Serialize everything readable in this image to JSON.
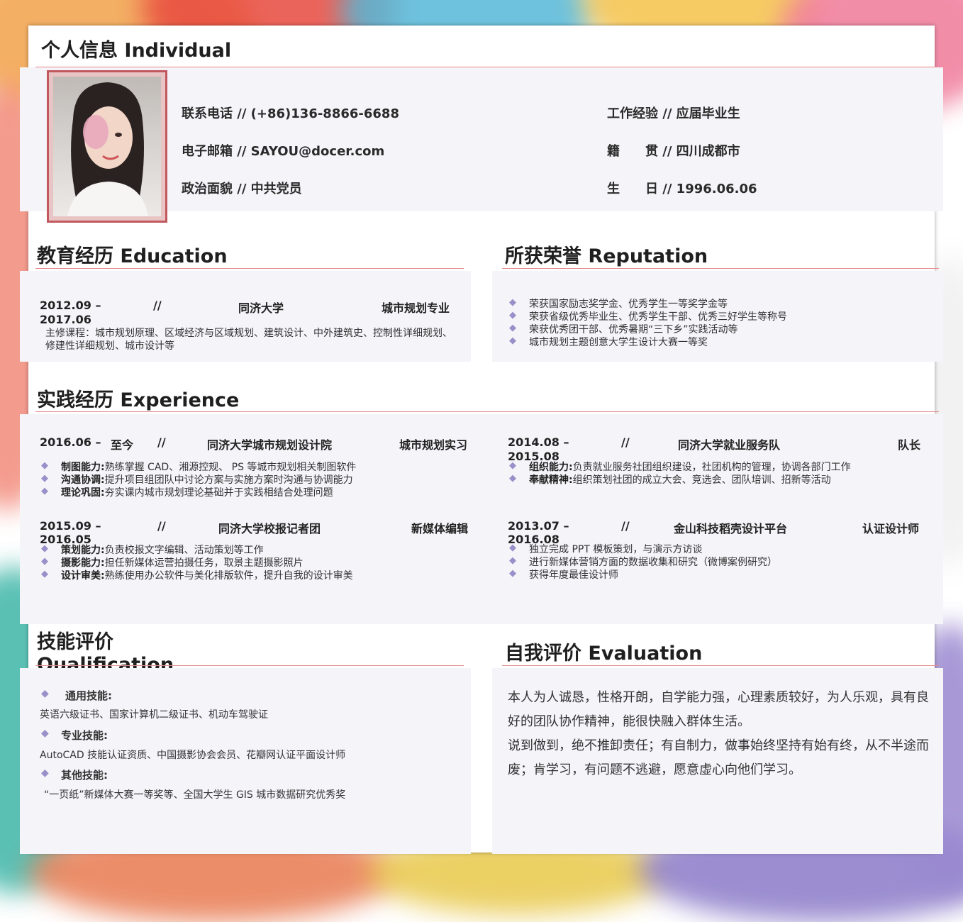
{
  "personal": {
    "title": "个人信息 Individual",
    "phone": "联系电话 // (+86)136-8866-6688",
    "email": "电子邮箱 // SAYOU@docer.com",
    "politics": "政治面貌 // 中共党员",
    "experience": "工作经验 // 应届毕业生",
    "hometown": "籍　　贯 // 四川成都市",
    "birthday": "生　　日 // 1996.06.06"
  },
  "education": {
    "title": "教育经历 Education",
    "date_start": "2012.09 –",
    "date_end": "2017.06",
    "sep": "//",
    "school": "同济大学",
    "major": "城市规划专业",
    "courses": "主修课程：城市规划原理、区域经济与区域规划、建筑设计、中外建筑史、控制性详细规划、修建性详细规划、城市设计等"
  },
  "reputation": {
    "title": "所获荣誉 Reputation",
    "items": [
      "荣获国家励志奖学金、优秀学生一等奖学金等",
      "荣获省级优秀毕业生、优秀学生干部、优秀三好学生等称号",
      "荣获优秀团干部、优秀暑期“三下乡”实践活动等",
      "城市规划主题创意大学生设计大赛一等奖"
    ]
  },
  "experience": {
    "title": "实践经历 Experience",
    "entries": [
      {
        "date_start": "2016.06 –",
        "date_end": "至今",
        "sep": "//",
        "org": "同济大学城市规划设计院",
        "role": "城市规划实习",
        "points": [
          {
            "label": "制图能力:",
            "text": "熟练掌握 CAD、湘源控规、 PS 等城市规划相关制图软件"
          },
          {
            "label": "沟通协调:",
            "text": "提升项目组团队中讨论方案与实施方案时沟通与协调能力"
          },
          {
            "label": "理论巩固:",
            "text": "夯实课内城市规划理论基础并于实践相结合处理问题"
          }
        ]
      },
      {
        "date_start": "2015.09 –",
        "date_end": "2016.05",
        "sep": "//",
        "org": "同济大学校报记者团",
        "role": "新媒体编辑",
        "points": [
          {
            "label": "策划能力:",
            "text": "负责校报文字编辑、活动策划等工作"
          },
          {
            "label": "摄影能力:",
            "text": "担任新媒体运营拍摄任务，取景主题摄影照片"
          },
          {
            "label": "设计审美:",
            "text": "熟练使用办公软件与美化排版软件，提升自我的设计审美"
          }
        ]
      },
      {
        "date_start": "2014.08 –",
        "date_end": "2015.08",
        "sep": "//",
        "org": "同济大学就业服务队",
        "role": "队长",
        "points": [
          {
            "label": "组织能力:",
            "text": "负责就业服务社团组织建设，社团机构的管理，协调各部门工作"
          },
          {
            "label": "奉献精神:",
            "text": "组织策划社团的成立大会、竞选会、团队培训、招新等活动"
          }
        ]
      },
      {
        "date_start": "2013.07 –",
        "date_end": "2016.08",
        "sep": "//",
        "org": "金山科技稻壳设计平台",
        "role": "认证设计师",
        "points": [
          {
            "label": "",
            "text": "独立完成 PPT 模板策划，与演示方访谈"
          },
          {
            "label": "",
            "text": "进行新媒体营销方面的数据收集和研究（微博案例研究）"
          },
          {
            "label": "",
            "text": "获得年度最佳设计师"
          }
        ]
      }
    ]
  },
  "qualification": {
    "title_cn": "技能评价",
    "title_en": "Qualification",
    "groups": [
      {
        "label": "通用技能:",
        "text": "英语六级证书、国家计算机二级证书、机动车驾驶证"
      },
      {
        "label": "专业技能:",
        "text": "AutoCAD 技能认证资质、中国摄影协会会员、花瓣网认证平面设计师"
      },
      {
        "label": "其他技能:",
        "text": "“一页纸”新媒体大赛一等奖等、全国大学生 GIS 城市数据研究优秀奖"
      }
    ]
  },
  "evaluation": {
    "title": "自我评价 Evaluation",
    "para1": "本人为人诚恳，性格开朗，自学能力强，心理素质较好，为人乐观，具有良好的团队协作精神，能很快融入群体生活。",
    "para2": "说到做到，绝不推卸责任；有自制力，做事始终坚持有始有终，从不半途而废；肯学习，有问题不逃避，愿意虚心向他们学习。"
  },
  "colors": {
    "accent_line": "#e58a8a",
    "panel_bg": "#f4f4f9",
    "bullet": "#9a8fc8",
    "photo_border": "#c0585e"
  }
}
